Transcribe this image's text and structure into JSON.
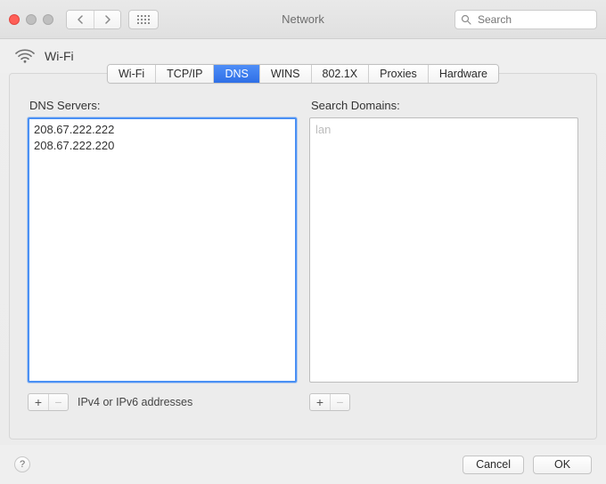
{
  "window": {
    "title": "Network",
    "search_placeholder": "Search"
  },
  "interface": {
    "name": "Wi-Fi"
  },
  "tabs": [
    {
      "label": "Wi-Fi"
    },
    {
      "label": "TCP/IP"
    },
    {
      "label": "DNS",
      "active": true
    },
    {
      "label": "WINS"
    },
    {
      "label": "802.1X"
    },
    {
      "label": "Proxies"
    },
    {
      "label": "Hardware"
    }
  ],
  "dns": {
    "servers_label": "DNS Servers:",
    "servers": [
      "208.67.222.222",
      "208.67.222.220"
    ],
    "search_domains_label": "Search Domains:",
    "search_domains_placeholder": "lan",
    "hint": "IPv4 or IPv6 addresses",
    "plus": "+",
    "minus": "−"
  },
  "footer": {
    "help": "?",
    "cancel": "Cancel",
    "ok": "OK"
  }
}
